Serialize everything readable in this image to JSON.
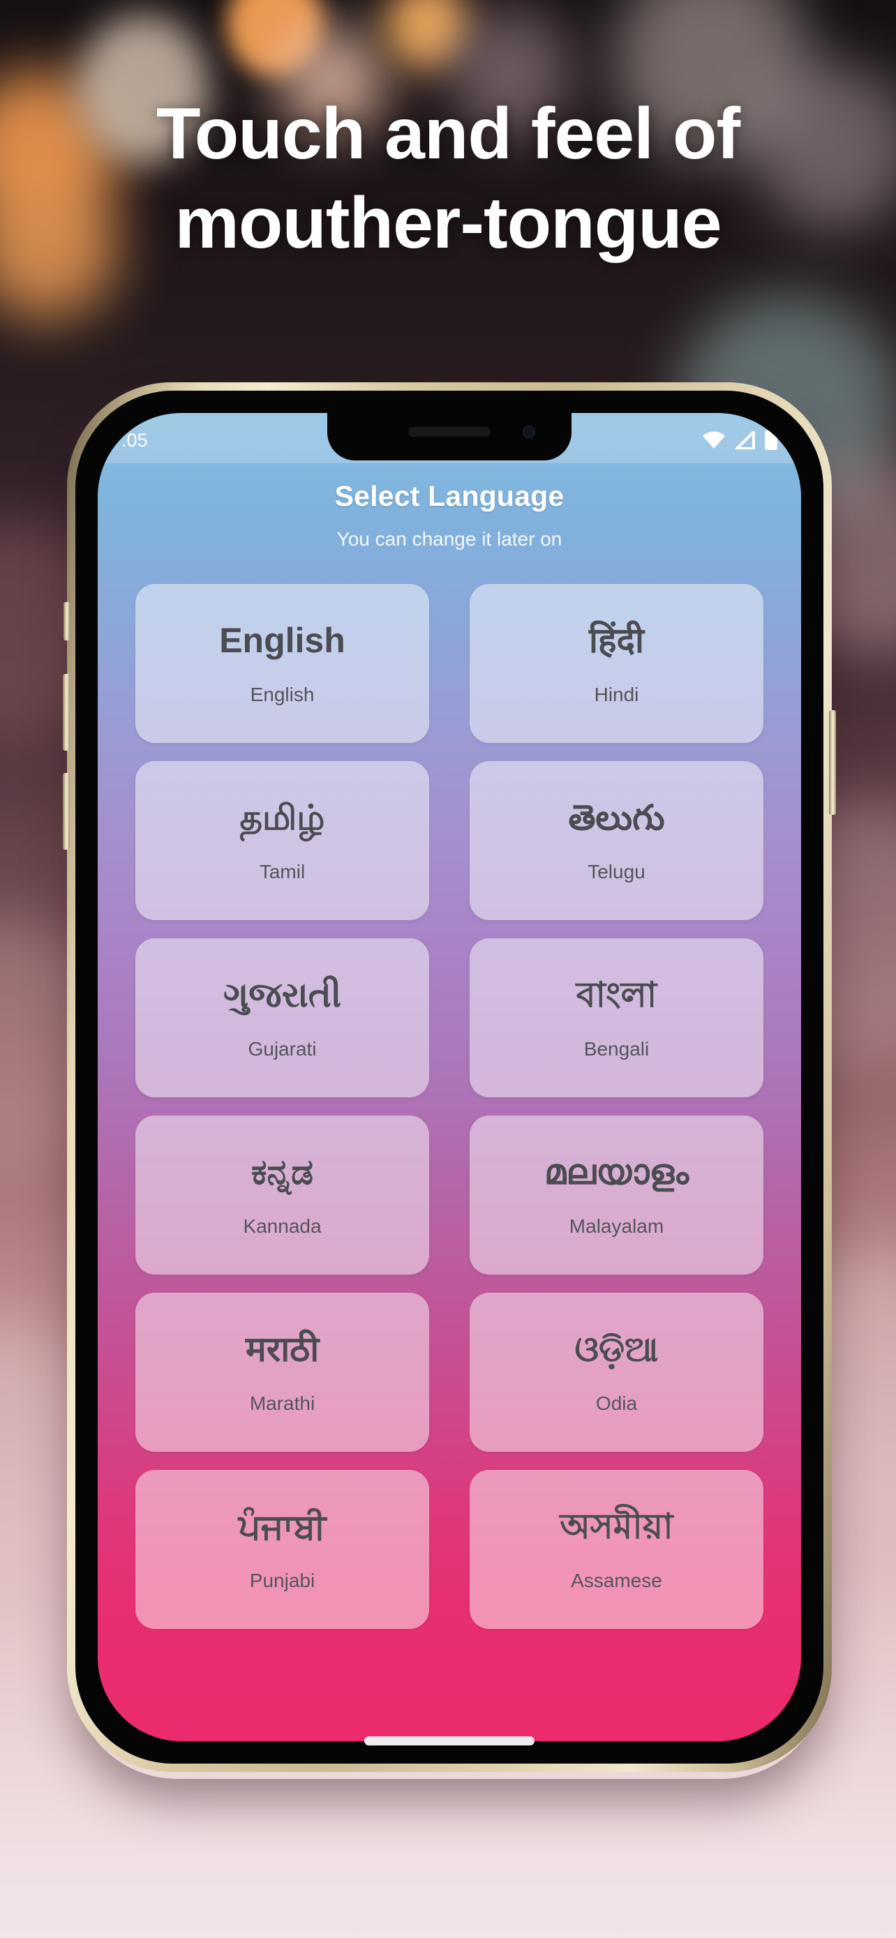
{
  "promo": {
    "headline_line1": "Touch and feel of",
    "headline_line2": "mouther-tongue"
  },
  "status_bar": {
    "time": ".05",
    "wifi_icon": "wifi-icon",
    "signal_icon": "signal-icon",
    "battery_icon": "battery-icon"
  },
  "app": {
    "title": "Select Language",
    "subtitle": "You can change it later on",
    "languages": [
      {
        "native": "English",
        "english": "English"
      },
      {
        "native": "हिंदी",
        "english": "Hindi"
      },
      {
        "native": "தமிழ்",
        "english": "Tamil"
      },
      {
        "native": "తెలుగు",
        "english": "Telugu"
      },
      {
        "native": "ગુજરાતી",
        "english": "Gujarati"
      },
      {
        "native": "বাংলা",
        "english": "Bengali"
      },
      {
        "native": "ಕನ್ನಡ",
        "english": "Kannada"
      },
      {
        "native": "മലയാളം",
        "english": "Malayalam"
      },
      {
        "native": "मराठी",
        "english": "Marathi"
      },
      {
        "native": "ଓଡ଼ିଆ",
        "english": "Odia"
      },
      {
        "native": "ਪੰਜਾਬੀ",
        "english": "Punjabi"
      },
      {
        "native": "অসমীয়া",
        "english": "Assamese"
      }
    ]
  },
  "colors": {
    "screen_top": "#85bce0",
    "screen_bottom": "#ec2a6e",
    "card_fill": "rgba(255,255,255,0.48)",
    "headline_text": "#ffffff",
    "phone_frame": "#e8dcb8",
    "page_background": "#efe3e8"
  }
}
